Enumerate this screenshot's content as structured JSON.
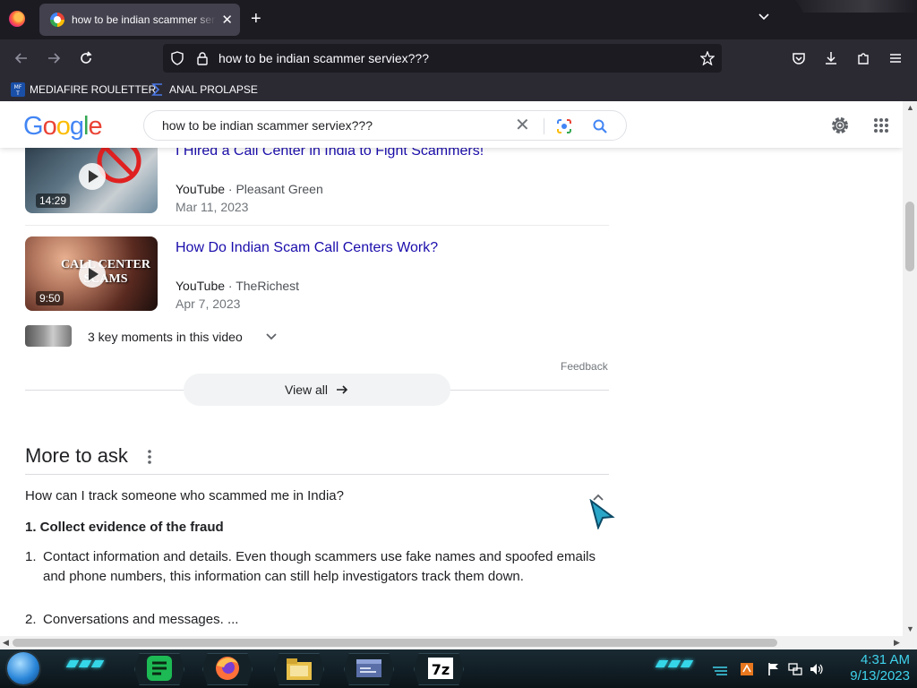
{
  "browser": {
    "tab": {
      "title": "how to be indian scammer serviex???",
      "close": "✕"
    },
    "new_tab": "+",
    "url": "how to be indian scammer serviex???",
    "bookmarks": [
      {
        "label": "MEDIAFIRE ROULETTER",
        "icon": "mediafire-icon"
      },
      {
        "label": "ANAL PROLAPSE",
        "icon": "sigma-icon"
      }
    ]
  },
  "google": {
    "logo": [
      "G",
      "o",
      "o",
      "g",
      "l",
      "e"
    ],
    "query": "how to be indian scammer serviex???",
    "clear": "✕"
  },
  "videos": [
    {
      "title": "I Hired a Call Center in India to Fight Scammers!",
      "source": "YouTube",
      "channel": "Pleasant Green",
      "date": "Mar 11, 2023",
      "duration": "14:29"
    },
    {
      "title": "How Do Indian Scam Call Centers Work?",
      "source": "YouTube",
      "channel": "TheRichest",
      "date": "Apr 7, 2023",
      "duration": "9:50",
      "thumb_text": "CALL CENTER SCAMS"
    }
  ],
  "key_moments": "3 key moments in this video",
  "feedback": "Feedback",
  "view_all": "View all",
  "meta_sep": "·",
  "more_to_ask": {
    "heading": "More to ask",
    "question": "How can I track someone who scammed me in India?",
    "answer_heading": "1. Collect evidence of the fraud",
    "answer_items": [
      {
        "num": "1.",
        "text": "Contact information and details. Even though scammers use fake names and spoofed emails and phone numbers, this information can still help investigators track them down."
      },
      {
        "num": "2.",
        "text": "Conversations and messages. ..."
      }
    ]
  },
  "taskbar": {
    "clock_time": "4:31 AM",
    "clock_date": "9/13/2023"
  },
  "colors": {
    "link": "#1a0dab",
    "chrome_dark": "#1c1b22",
    "taskbar_accent": "#3fd3ec"
  }
}
